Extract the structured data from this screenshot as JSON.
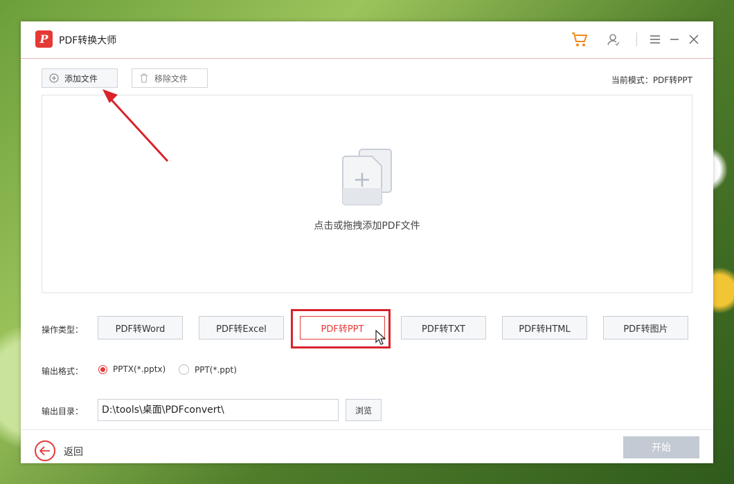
{
  "app": {
    "logo_letter": "P",
    "title": "PDF转换大师"
  },
  "titlebar_icons": [
    "cart-icon",
    "user-icon",
    "menu-icon",
    "minimize-icon",
    "close-icon"
  ],
  "toolbar": {
    "add_label": "添加文件",
    "remove_label": "移除文件",
    "mode_label": "当前模式：PDF转PPT"
  },
  "dropzone": {
    "hint": "点击或拖拽添加PDF文件"
  },
  "operation": {
    "label": "操作类型：",
    "types": [
      "PDF转Word",
      "PDF转Excel",
      "PDF转PPT",
      "PDF转TXT",
      "PDF转HTML",
      "PDF转图片"
    ],
    "selected": "PDF转PPT"
  },
  "format": {
    "label": "输出格式：",
    "options": [
      "PPTX(*.pptx)",
      "PPT(*.ppt)"
    ],
    "selected": "PPTX(*.pptx)"
  },
  "output": {
    "label": "输出目录：",
    "path": "D:\\tools\\桌面\\PDFconvert\\",
    "browse_label": "浏览"
  },
  "footer": {
    "back_label": "返回",
    "start_label": "开始"
  },
  "colors": {
    "accent": "#e53935",
    "annotation": "#d9222a"
  }
}
